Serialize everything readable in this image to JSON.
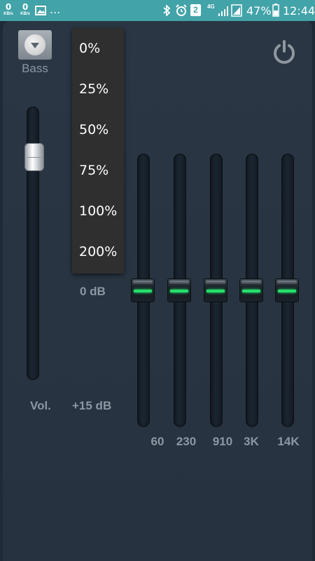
{
  "status_bar": {
    "net_down": {
      "value": "0",
      "unit": "KB/s"
    },
    "net_up": {
      "value": "0",
      "unit": "KB/s"
    },
    "more": "...",
    "sim_badge": "2",
    "network_type": "4G",
    "battery_percent": "47%",
    "time": "12:44",
    "icons": [
      "image-icon",
      "bluetooth-icon",
      "alarm-icon",
      "signal-icon",
      "battery-icon"
    ]
  },
  "bass": {
    "label": "Bass"
  },
  "volume": {
    "label": "Vol.",
    "level": 0.18
  },
  "db_labels": {
    "zero": "0 dB",
    "plus15": "+15 dB"
  },
  "dropdown": {
    "options": [
      "0%",
      "25%",
      "50%",
      "75%",
      "100%",
      "200%"
    ]
  },
  "equalizer": {
    "bands": [
      {
        "label": "60"
      },
      {
        "label": "230"
      },
      {
        "label": "910"
      },
      {
        "label": "3K"
      },
      {
        "label": "14K"
      }
    ]
  },
  "colors": {
    "status_bar": "#42a3a8",
    "background": "#26323f",
    "knob_indicator": "#26e06c",
    "dropdown_bg": "#2f2f2f",
    "label_text": "#8c97a3"
  }
}
